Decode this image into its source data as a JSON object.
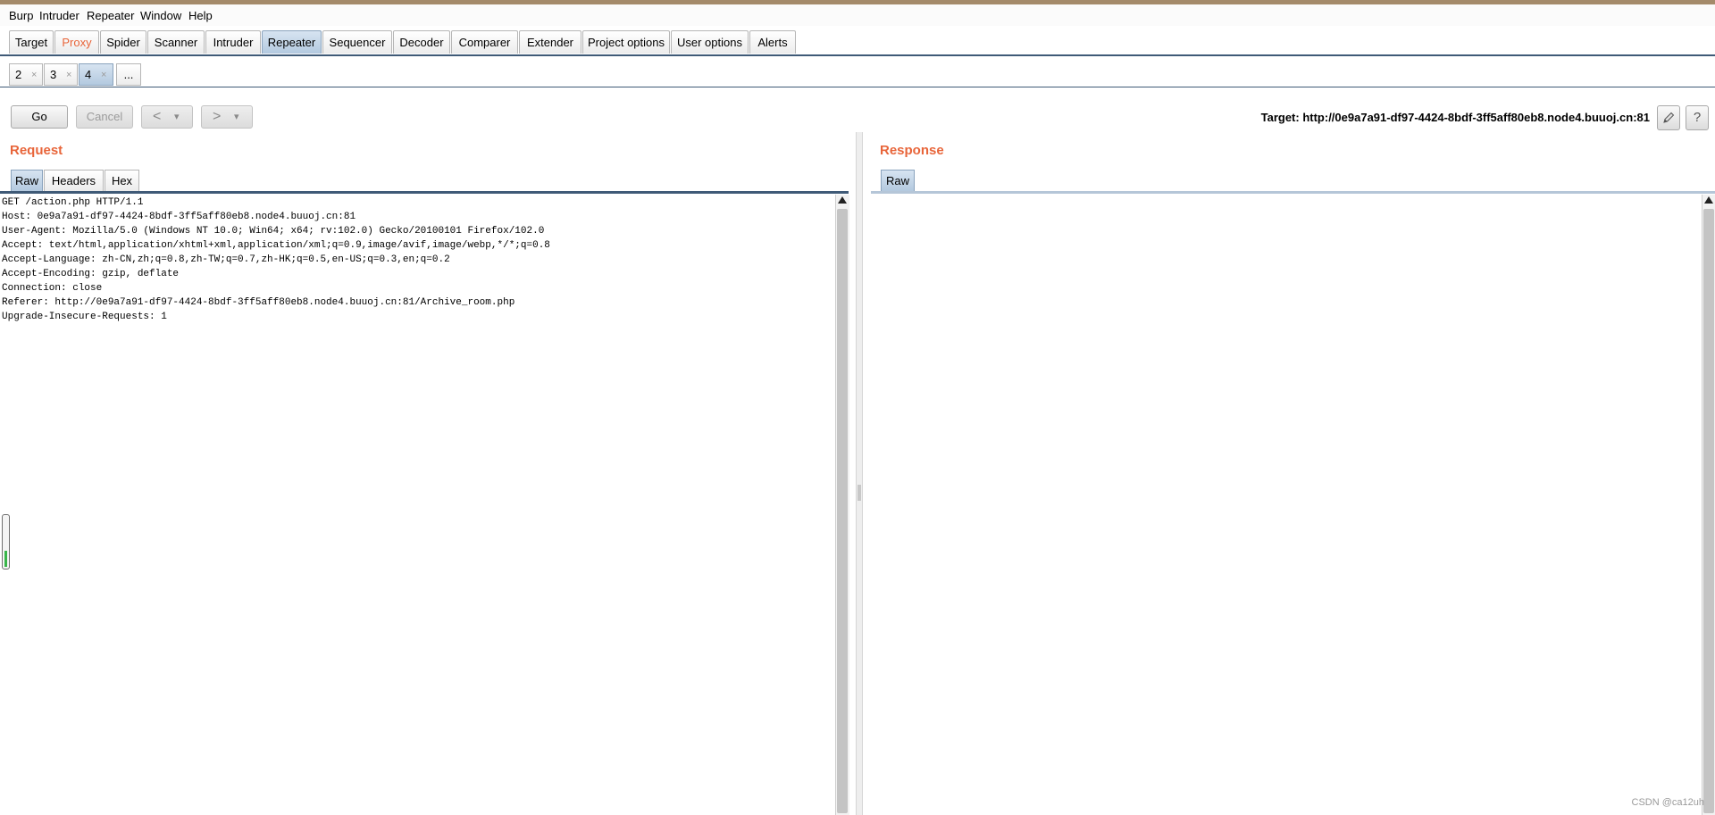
{
  "menubar": {
    "items": [
      "Burp",
      "Intruder",
      "Repeater",
      "Window",
      "Help"
    ]
  },
  "main_tabs": [
    "Target",
    "Proxy",
    "Spider",
    "Scanner",
    "Intruder",
    "Repeater",
    "Sequencer",
    "Decoder",
    "Comparer",
    "Extender",
    "Project options",
    "User options",
    "Alerts"
  ],
  "active_main_tab": "Repeater",
  "highlighted_main_tab": "Proxy",
  "repeater_tabs": {
    "tabs": [
      {
        "number": "2",
        "close": "×"
      },
      {
        "number": "3",
        "close": "×"
      },
      {
        "number": "4",
        "close": "×"
      }
    ],
    "more_label": "...",
    "active": "4"
  },
  "toolbar": {
    "go_label": "Go",
    "cancel_label": "Cancel",
    "back_label": "<",
    "forward_label": ">",
    "dropdown_glyph": "▾"
  },
  "target": {
    "label": "Target: http://0e9a7a91-df97-4424-8bdf-3ff5aff80eb8.node4.buuoj.cn:81",
    "edit_icon": "pencil-icon",
    "help_icon": "help-icon",
    "help_glyph": "?"
  },
  "request": {
    "title": "Request",
    "tabs": [
      "Raw",
      "Headers",
      "Hex"
    ],
    "active_tab": "Raw",
    "lines": [
      "GET /action.php HTTP/1.1",
      "Host: 0e9a7a91-df97-4424-8bdf-3ff5aff80eb8.node4.buuoj.cn:81",
      "User-Agent: Mozilla/5.0 (Windows NT 10.0; Win64; x64; rv:102.0) Gecko/20100101 Firefox/102.0",
      "Accept: text/html,application/xhtml+xml,application/xml;q=0.9,image/avif,image/webp,*/*;q=0.8",
      "Accept-Language: zh-CN,zh;q=0.8,zh-TW;q=0.7,zh-HK;q=0.5,en-US;q=0.3,en;q=0.2",
      "Accept-Encoding: gzip, deflate",
      "Connection: close",
      "Referer: http://0e9a7a91-df97-4424-8bdf-3ff5aff80eb8.node4.buuoj.cn:81/Archive_room.php",
      "Upgrade-Insecure-Requests: 1"
    ]
  },
  "response": {
    "title": "Response",
    "tabs": [
      "Raw"
    ],
    "active_tab": "Raw"
  },
  "watermark": "CSDN @ca12uh",
  "colors": {
    "accent_orange": "#e8653a",
    "active_tab_blue": "#b3c9df",
    "rule_navy": "#3f5a77"
  }
}
